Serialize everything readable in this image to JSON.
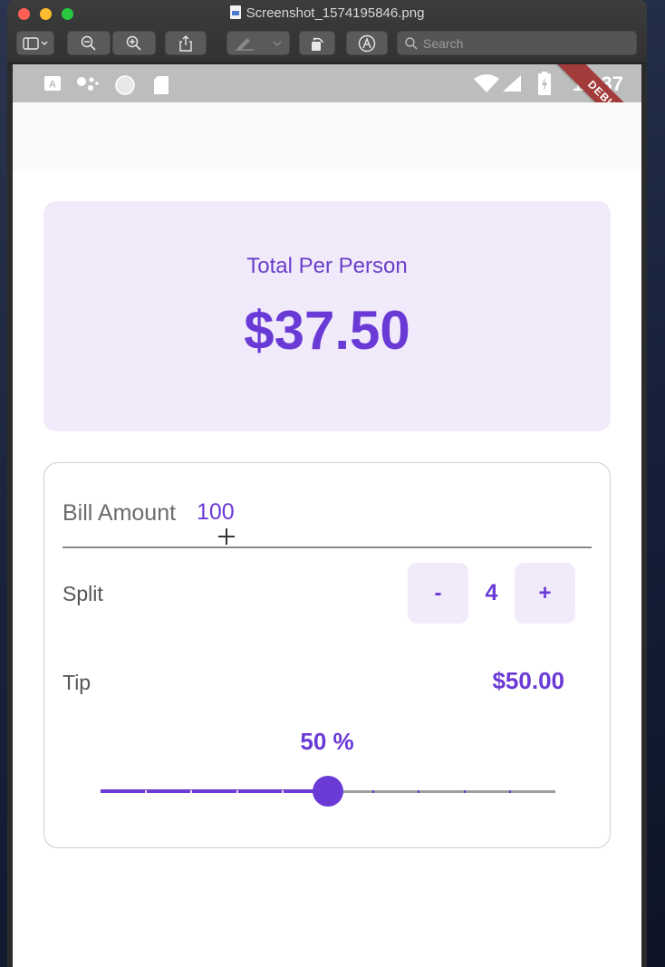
{
  "window": {
    "title": "Screenshot_1574195846.png",
    "search_placeholder": "Search"
  },
  "statusbar": {
    "time": "12:37",
    "debug_label": "DEBUG"
  },
  "summary": {
    "label": "Total Per Person",
    "value": "$37.50"
  },
  "bill": {
    "label": "Bill Amount",
    "value": "100"
  },
  "split": {
    "label": "Split",
    "minus_label": "-",
    "plus_label": "+",
    "value": "4"
  },
  "tip": {
    "label": "Tip",
    "amount": "$50.00",
    "percent_label": "50 %",
    "slider_fraction": 0.5,
    "slider_divisions": 10
  },
  "colors": {
    "accent": "#6a3ad6",
    "card_bg": "#f1eafb"
  }
}
